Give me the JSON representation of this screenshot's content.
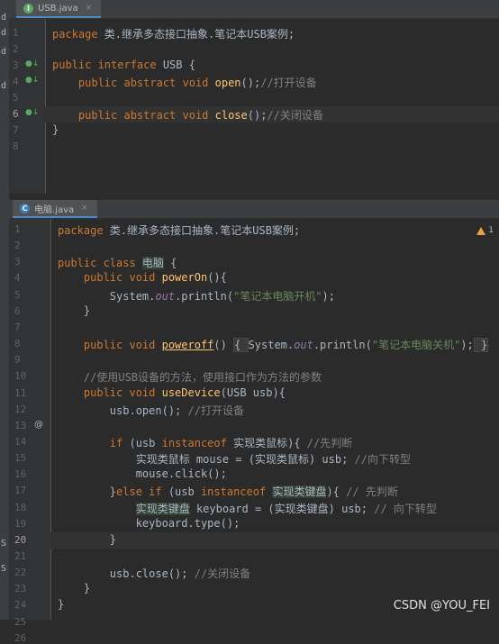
{
  "left_strip": {
    "fragments": [
      "d",
      "d",
      "d",
      "d",
      "S",
      "S"
    ]
  },
  "top_editor": {
    "tab": {
      "label": "USB.java",
      "icon": "interface-icon",
      "icon_glyph": "I",
      "close": "×"
    },
    "current_line": 6,
    "line_numbers": [
      "1",
      "2",
      "3",
      "4",
      "5",
      "6",
      "7",
      "8"
    ],
    "lines": [
      [
        [
          "kw",
          "package "
        ],
        [
          "pl",
          "类.继承多态接口抽象.笔记本USB案例;"
        ]
      ],
      [],
      [
        [
          "kw",
          "public interface "
        ],
        [
          "pl",
          "USB {"
        ]
      ],
      [
        [
          "pl",
          "    "
        ],
        [
          "kw",
          "public abstract void "
        ],
        [
          "fn",
          "open"
        ],
        [
          "pl",
          "();"
        ],
        [
          "cm",
          "//打开设备"
        ]
      ],
      [],
      [
        [
          "pl",
          "    "
        ],
        [
          "kw",
          "public abstract void "
        ],
        [
          "fn",
          "close"
        ],
        [
          "pl",
          "();"
        ],
        [
          "cm",
          "//关闭设备"
        ]
      ],
      [
        [
          "pl",
          "}"
        ]
      ],
      []
    ]
  },
  "bottom_editor": {
    "tab": {
      "label": "电脑.java",
      "icon": "class-icon",
      "icon_glyph": "C",
      "close": "×"
    },
    "current_line": 20,
    "warning": {
      "icon": "warning-icon",
      "count": "1"
    },
    "line_numbers": [
      "1",
      "2",
      "3",
      "4",
      "5",
      "6",
      "7",
      "8",
      "9",
      "10",
      "11",
      "12",
      "13",
      "14",
      "15",
      "16",
      "17",
      "18",
      "19",
      "20",
      "21",
      "22",
      "23",
      "24",
      "25",
      "26"
    ],
    "lines": [
      [
        [
          "kw",
          "package "
        ],
        [
          "pl",
          "类.继承多态接口抽象.笔记本USB案例;"
        ]
      ],
      [],
      [
        [
          "kw",
          "public class "
        ],
        [
          "hl",
          "电脑"
        ],
        [
          "pl",
          " {"
        ]
      ],
      [
        [
          "pl",
          "    "
        ],
        [
          "kw",
          "public void "
        ],
        [
          "fn",
          "powerOn"
        ],
        [
          "pl",
          "(){"
        ]
      ],
      [
        [
          "pl",
          "        System."
        ],
        [
          "fld",
          "out"
        ],
        [
          "pl",
          ".println("
        ],
        [
          "st",
          "\"笔记本电脑开机\""
        ],
        [
          "pl",
          ");"
        ]
      ],
      [
        [
          "pl",
          "    }"
        ]
      ],
      [],
      [
        [
          "pl",
          "    "
        ],
        [
          "kw",
          "public void "
        ],
        [
          "fnu",
          "poweroff"
        ],
        [
          "pl",
          "() "
        ],
        [
          "fold",
          "{ "
        ],
        [
          "pl",
          "System."
        ],
        [
          "fld",
          "out"
        ],
        [
          "pl",
          ".println("
        ],
        [
          "st",
          "\"笔记本电脑关机\""
        ],
        [
          "pl",
          ");"
        ],
        [
          "fold",
          " }"
        ]
      ],
      [],
      [
        [
          "pl",
          "    "
        ],
        [
          "cm",
          "//使用USB设备的方法，使用接口作为方法的参数"
        ]
      ],
      [
        [
          "pl",
          "    "
        ],
        [
          "kw",
          "public void "
        ],
        [
          "fn",
          "useDevice"
        ],
        [
          "pl",
          "(USB usb){"
        ]
      ],
      [
        [
          "pl",
          "        usb.open(); "
        ],
        [
          "cm",
          "//打开设备"
        ]
      ],
      [],
      [
        [
          "pl",
          "        "
        ],
        [
          "kw",
          "if "
        ],
        [
          "pl",
          "(usb "
        ],
        [
          "kw",
          "instanceof "
        ],
        [
          "pl",
          "实现类鼠标){ "
        ],
        [
          "cm",
          "//先判断"
        ]
      ],
      [
        [
          "pl",
          "            实现类鼠标 mouse = (实现类鼠标) usb; "
        ],
        [
          "cm",
          "//向下转型"
        ]
      ],
      [
        [
          "pl",
          "            mouse.click();"
        ]
      ],
      [
        [
          "pl",
          "        }"
        ],
        [
          "kw",
          "else if "
        ],
        [
          "pl",
          "(usb "
        ],
        [
          "kw",
          "instanceof "
        ],
        [
          "hl",
          "实现类键盘"
        ],
        [
          "pl",
          "){ "
        ],
        [
          "cm",
          "// 先判断"
        ]
      ],
      [
        [
          "pl",
          "            "
        ],
        [
          "hl",
          "实现类键盘"
        ],
        [
          "pl",
          " keyboard = (实现类键盘) usb; "
        ],
        [
          "cm",
          "// 向下转型"
        ]
      ],
      [
        [
          "pl",
          "            keyboard.type();"
        ]
      ],
      [
        [
          "pl",
          "        }"
        ]
      ],
      [],
      [
        [
          "pl",
          "        usb.close(); "
        ],
        [
          "cm",
          "//关闭设备"
        ]
      ],
      [
        [
          "pl",
          "    }"
        ]
      ],
      [
        [
          "pl",
          "}"
        ]
      ]
    ]
  },
  "watermark": "CSDN @YOU_FEI",
  "colors": {
    "keyword": "#cc7832",
    "function": "#ffc66d",
    "string": "#6a8759",
    "comment": "#808080",
    "field": "#9876aa",
    "text": "#a9b7c6",
    "background": "#2b2b2b"
  }
}
